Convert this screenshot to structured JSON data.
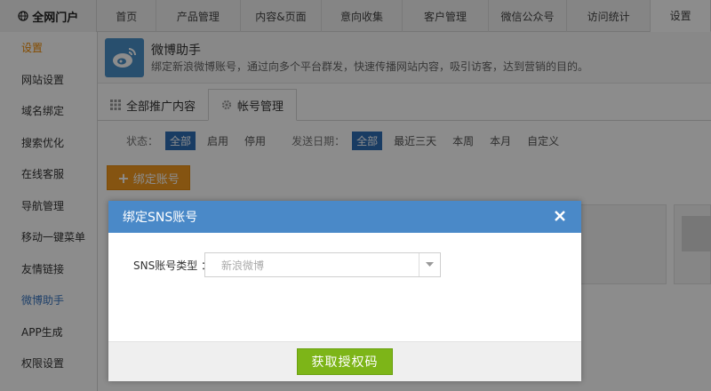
{
  "brand": {
    "name": "全网门户"
  },
  "nav": [
    "首页",
    "产品管理",
    "内容&页面",
    "意向收集",
    "客户管理",
    "微信公众号",
    "访问统计",
    "设置"
  ],
  "sidebar": {
    "items": [
      "设置",
      "网站设置",
      "域名绑定",
      "搜索优化",
      "在线客服",
      "导航管理",
      "移动一键菜单",
      "友情链接",
      "微博助手",
      "APP生成",
      "权限设置"
    ]
  },
  "app": {
    "title": "微博助手",
    "desc": "绑定新浪微博账号，通过向多个平台群发，快速传播网站内容，吸引访客，达到营销的目的。"
  },
  "tabs": [
    "全部推广内容",
    "帐号管理"
  ],
  "filters": {
    "status_label": "状态：",
    "status_options": [
      "全部",
      "启用",
      "停用"
    ],
    "date_label": "发送日期：",
    "date_options": [
      "全部",
      "最近三天",
      "本周",
      "本月",
      "自定义"
    ]
  },
  "bind_button": {
    "plus": "+",
    "label": "绑定账号"
  },
  "modal": {
    "title": "绑定SNS账号",
    "field_label": "SNS账号类型 ：",
    "select_value": "新浪微博",
    "submit": "获取授权码"
  },
  "colors": {
    "accent": "#f08a00",
    "header_blue": "#4a89c8",
    "submit_green": "#7db518",
    "chip_blue": "#2f6db5"
  }
}
